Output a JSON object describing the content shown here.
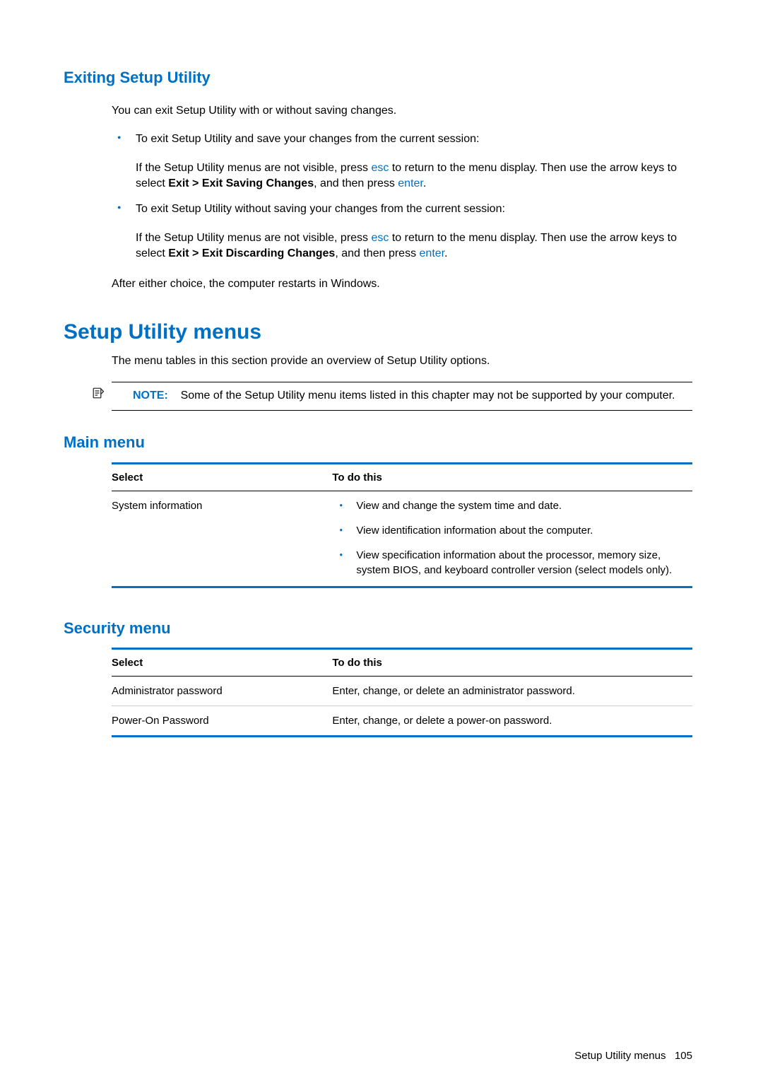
{
  "headings": {
    "exiting": "Exiting Setup Utility",
    "menus": "Setup Utility menus",
    "main": "Main menu",
    "security": "Security menu"
  },
  "exiting": {
    "intro": "You can exit Setup Utility with or without saving changes.",
    "bullets": [
      {
        "lead": "To exit Setup Utility and save your changes from the current session:",
        "sub_pre": "If the Setup Utility menus are not visible, press ",
        "sub_esc": "esc",
        "sub_mid1": " to return to the menu display. Then use the arrow keys to select ",
        "sub_bold": "Exit > Exit Saving Changes",
        "sub_mid2": ", and then press ",
        "sub_enter": "enter",
        "sub_end": "."
      },
      {
        "lead": "To exit Setup Utility without saving your changes from the current session:",
        "sub_pre": "If the Setup Utility menus are not visible, press ",
        "sub_esc": "esc",
        "sub_mid1": " to return to the menu display. Then use the arrow keys to select ",
        "sub_bold": "Exit > Exit Discarding Changes",
        "sub_mid2": ", and then press ",
        "sub_enter": "enter",
        "sub_end": "."
      }
    ],
    "closing": "After either choice, the computer restarts in Windows."
  },
  "menus": {
    "intro": "The menu tables in this section provide an overview of Setup Utility options.",
    "note_label": "NOTE:",
    "note_text": "Some of the Setup Utility menu items listed in this chapter may not be supported by your computer."
  },
  "table_headers": {
    "select": "Select",
    "todo": "To do this"
  },
  "main_table": {
    "row_select": "System information",
    "row_items": [
      "View and change the system time and date.",
      "View identification information about the computer.",
      "View specification information about the processor, memory size, system BIOS, and keyboard controller version (select models only)."
    ]
  },
  "security_table": {
    "rows": [
      {
        "select": "Administrator password",
        "todo": "Enter, change, or delete an administrator password."
      },
      {
        "select": "Power-On Password",
        "todo": "Enter, change, or delete a power-on password."
      }
    ]
  },
  "footer": {
    "label": "Setup Utility menus",
    "page": "105"
  }
}
